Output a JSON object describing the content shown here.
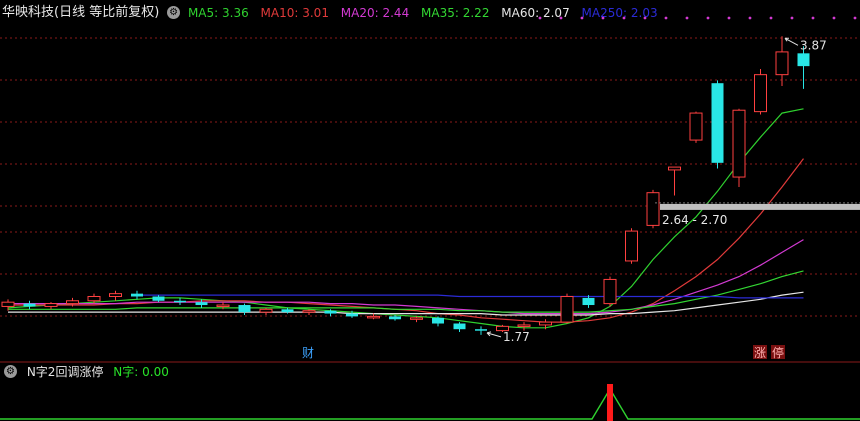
{
  "header": {
    "title": "华映科技(日线 等比前复权)",
    "gear_icon": "gear-icon",
    "ma": [
      {
        "label": "MA5: 3.36",
        "color": "#2fd12f"
      },
      {
        "label": "MA10: 3.01",
        "color": "#e03a3a"
      },
      {
        "label": "MA20: 2.44",
        "color": "#d23ad2"
      },
      {
        "label": "MA35: 2.22",
        "color": "#33d733"
      },
      {
        "label": "MA60: 2.07",
        "color": "#e6e6e6"
      },
      {
        "label": "MA250: 2.03",
        "color": "#2b2bd6"
      }
    ]
  },
  "sub_header": {
    "title": "N字2回调涨停",
    "value": "N字: 0.00"
  },
  "annotations": {
    "high_label": "3.87",
    "low_label": "1.77",
    "range_label": "2.64 - 2.70",
    "event_cai": "财",
    "event_zhang": "涨",
    "event_ting": "停"
  },
  "colors": {
    "up": "#ff4040",
    "down": "#29e6e6",
    "grid": "#8a1a1a",
    "support": "#c0c0c0",
    "signal_line": "#2fd12f",
    "signal_bar": "#ff1a1a"
  },
  "chart_data": {
    "type": "candlestick",
    "candles": [
      {
        "o": 1.97,
        "h": 2.02,
        "l": 1.94,
        "c": 2.0
      },
      {
        "o": 1.99,
        "h": 2.01,
        "l": 1.95,
        "c": 1.97
      },
      {
        "o": 1.97,
        "h": 2.0,
        "l": 1.95,
        "c": 1.99
      },
      {
        "o": 1.99,
        "h": 2.03,
        "l": 1.97,
        "c": 2.01
      },
      {
        "o": 2.01,
        "h": 2.06,
        "l": 1.99,
        "c": 2.04
      },
      {
        "o": 2.04,
        "h": 2.08,
        "l": 2.01,
        "c": 2.06
      },
      {
        "o": 2.06,
        "h": 2.08,
        "l": 2.02,
        "c": 2.04
      },
      {
        "o": 2.04,
        "h": 2.05,
        "l": 2.0,
        "c": 2.01
      },
      {
        "o": 2.01,
        "h": 2.03,
        "l": 1.98,
        "c": 2.0
      },
      {
        "o": 2.0,
        "h": 2.02,
        "l": 1.96,
        "c": 1.98
      },
      {
        "o": 1.98,
        "h": 2.0,
        "l": 1.95,
        "c": 1.98
      },
      {
        "o": 1.98,
        "h": 1.99,
        "l": 1.91,
        "c": 1.93
      },
      {
        "o": 1.93,
        "h": 1.96,
        "l": 1.91,
        "c": 1.95
      },
      {
        "o": 1.95,
        "h": 1.96,
        "l": 1.92,
        "c": 1.93
      },
      {
        "o": 1.93,
        "h": 1.95,
        "l": 1.91,
        "c": 1.94
      },
      {
        "o": 1.94,
        "h": 1.95,
        "l": 1.9,
        "c": 1.92
      },
      {
        "o": 1.92,
        "h": 1.94,
        "l": 1.89,
        "c": 1.9
      },
      {
        "o": 1.9,
        "h": 1.92,
        "l": 1.88,
        "c": 1.9
      },
      {
        "o": 1.9,
        "h": 1.91,
        "l": 1.87,
        "c": 1.88
      },
      {
        "o": 1.88,
        "h": 1.9,
        "l": 1.86,
        "c": 1.89
      },
      {
        "o": 1.89,
        "h": 1.9,
        "l": 1.83,
        "c": 1.85
      },
      {
        "o": 1.85,
        "h": 1.86,
        "l": 1.79,
        "c": 1.81
      },
      {
        "o": 1.81,
        "h": 1.83,
        "l": 1.77,
        "c": 1.8
      },
      {
        "o": 1.8,
        "h": 1.84,
        "l": 1.79,
        "c": 1.83
      },
      {
        "o": 1.83,
        "h": 1.86,
        "l": 1.8,
        "c": 1.84
      },
      {
        "o": 1.84,
        "h": 1.88,
        "l": 1.81,
        "c": 1.86
      },
      {
        "o": 1.86,
        "h": 2.06,
        "l": 1.85,
        "c": 2.04
      },
      {
        "o": 2.03,
        "h": 2.05,
        "l": 1.96,
        "c": 1.98
      },
      {
        "o": 1.99,
        "h": 2.18,
        "l": 1.97,
        "c": 2.16
      },
      {
        "o": 2.29,
        "h": 2.52,
        "l": 2.27,
        "c": 2.5
      },
      {
        "o": 2.54,
        "h": 2.79,
        "l": 2.52,
        "c": 2.77
      },
      {
        "o": 2.93,
        "h": 2.95,
        "l": 2.75,
        "c": 2.95
      },
      {
        "o": 3.14,
        "h": 3.34,
        "l": 3.12,
        "c": 3.33
      },
      {
        "o": 3.54,
        "h": 3.56,
        "l": 2.94,
        "c": 2.98
      },
      {
        "o": 2.88,
        "h": 3.36,
        "l": 2.81,
        "c": 3.35
      },
      {
        "o": 3.34,
        "h": 3.64,
        "l": 3.32,
        "c": 3.6
      },
      {
        "o": 3.6,
        "h": 3.87,
        "l": 3.52,
        "c": 3.76
      },
      {
        "o": 3.75,
        "h": 3.8,
        "l": 3.5,
        "c": 3.66
      }
    ],
    "ma_series": [
      {
        "name": "MA5",
        "values": [
          1.96,
          1.97,
          1.98,
          1.99,
          2.0,
          2.01,
          2.02,
          2.03,
          2.03,
          2.02,
          2.01,
          2.0,
          1.98,
          1.96,
          1.95,
          1.94,
          1.93,
          1.92,
          1.91,
          1.9,
          1.89,
          1.87,
          1.85,
          1.83,
          1.82,
          1.82,
          1.85,
          1.89,
          1.97,
          2.11,
          2.3,
          2.46,
          2.6,
          2.78,
          2.98,
          3.16,
          3.33,
          3.36
        ]
      },
      {
        "name": "MA10",
        "values": [
          1.98,
          1.98,
          1.98,
          1.98,
          1.98,
          1.99,
          1.99,
          2.0,
          2.0,
          2.01,
          2.01,
          2.01,
          2.0,
          2.0,
          1.99,
          1.98,
          1.97,
          1.96,
          1.95,
          1.94,
          1.92,
          1.91,
          1.89,
          1.88,
          1.87,
          1.86,
          1.86,
          1.87,
          1.89,
          1.93,
          1.99,
          2.08,
          2.18,
          2.3,
          2.45,
          2.62,
          2.81,
          3.01
        ]
      },
      {
        "name": "MA20",
        "values": [
          1.99,
          1.99,
          1.99,
          1.99,
          1.99,
          1.99,
          2.0,
          2.0,
          2.0,
          2.0,
          2.0,
          2.0,
          2.0,
          2.0,
          2.0,
          1.99,
          1.99,
          1.98,
          1.98,
          1.97,
          1.96,
          1.95,
          1.94,
          1.93,
          1.92,
          1.92,
          1.92,
          1.92,
          1.93,
          1.95,
          1.98,
          2.02,
          2.07,
          2.12,
          2.18,
          2.26,
          2.35,
          2.44
        ]
      },
      {
        "name": "MA35",
        "values": [
          1.95,
          1.95,
          1.95,
          1.95,
          1.95,
          1.95,
          1.96,
          1.96,
          1.96,
          1.96,
          1.96,
          1.96,
          1.96,
          1.96,
          1.96,
          1.96,
          1.96,
          1.96,
          1.95,
          1.95,
          1.95,
          1.94,
          1.94,
          1.93,
          1.93,
          1.93,
          1.93,
          1.93,
          1.94,
          1.95,
          1.97,
          1.99,
          2.02,
          2.05,
          2.09,
          2.13,
          2.18,
          2.22
        ]
      },
      {
        "name": "MA60",
        "values": [
          1.93,
          1.93,
          1.93,
          1.93,
          1.93,
          1.93,
          1.93,
          1.93,
          1.93,
          1.93,
          1.93,
          1.93,
          1.93,
          1.93,
          1.93,
          1.93,
          1.92,
          1.92,
          1.92,
          1.92,
          1.92,
          1.92,
          1.92,
          1.91,
          1.91,
          1.91,
          1.91,
          1.91,
          1.92,
          1.92,
          1.93,
          1.94,
          1.96,
          1.98,
          2.0,
          2.02,
          2.05,
          2.07
        ]
      },
      {
        "name": "MA250",
        "values": [
          null,
          null,
          null,
          null,
          null,
          null,
          2.05,
          2.05,
          2.05,
          2.05,
          2.05,
          2.05,
          2.05,
          2.05,
          2.05,
          2.05,
          2.05,
          2.05,
          2.05,
          2.05,
          2.05,
          2.04,
          2.04,
          2.04,
          2.04,
          2.04,
          2.04,
          2.04,
          2.04,
          2.04,
          2.04,
          2.04,
          2.04,
          2.04,
          2.03,
          2.03,
          2.03,
          2.03
        ]
      }
    ],
    "support_level": 2.67,
    "high_price": 3.87,
    "low_price": 1.77,
    "signal": {
      "index": 29,
      "value": 1
    }
  }
}
